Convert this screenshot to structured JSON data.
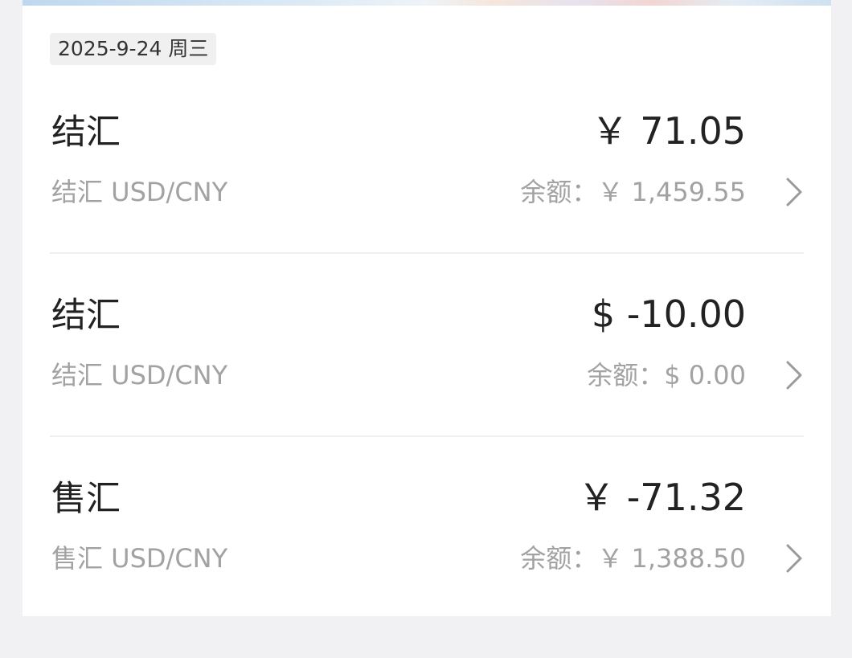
{
  "date": "2025-9-24 周三",
  "records": [
    {
      "type": "结汇",
      "amount": "￥ 71.05",
      "description": "结汇 USD/CNY",
      "balance": "余额：￥ 1,459.55"
    },
    {
      "type": "结汇",
      "amount": "$ -10.00",
      "description": "结汇 USD/CNY",
      "balance": "余额：$ 0.00"
    },
    {
      "type": "售汇",
      "amount": "￥ -71.32",
      "description": "售汇 USD/CNY",
      "balance": "余额：￥ 1,388.50"
    }
  ],
  "icons": {
    "chevron": "chevron-right-icon"
  },
  "colors": {
    "primary_text": "#222222",
    "secondary_text": "#a2a2a2",
    "date_tag_bg": "#f0f0f0",
    "page_bg": "#f1f1f3"
  }
}
